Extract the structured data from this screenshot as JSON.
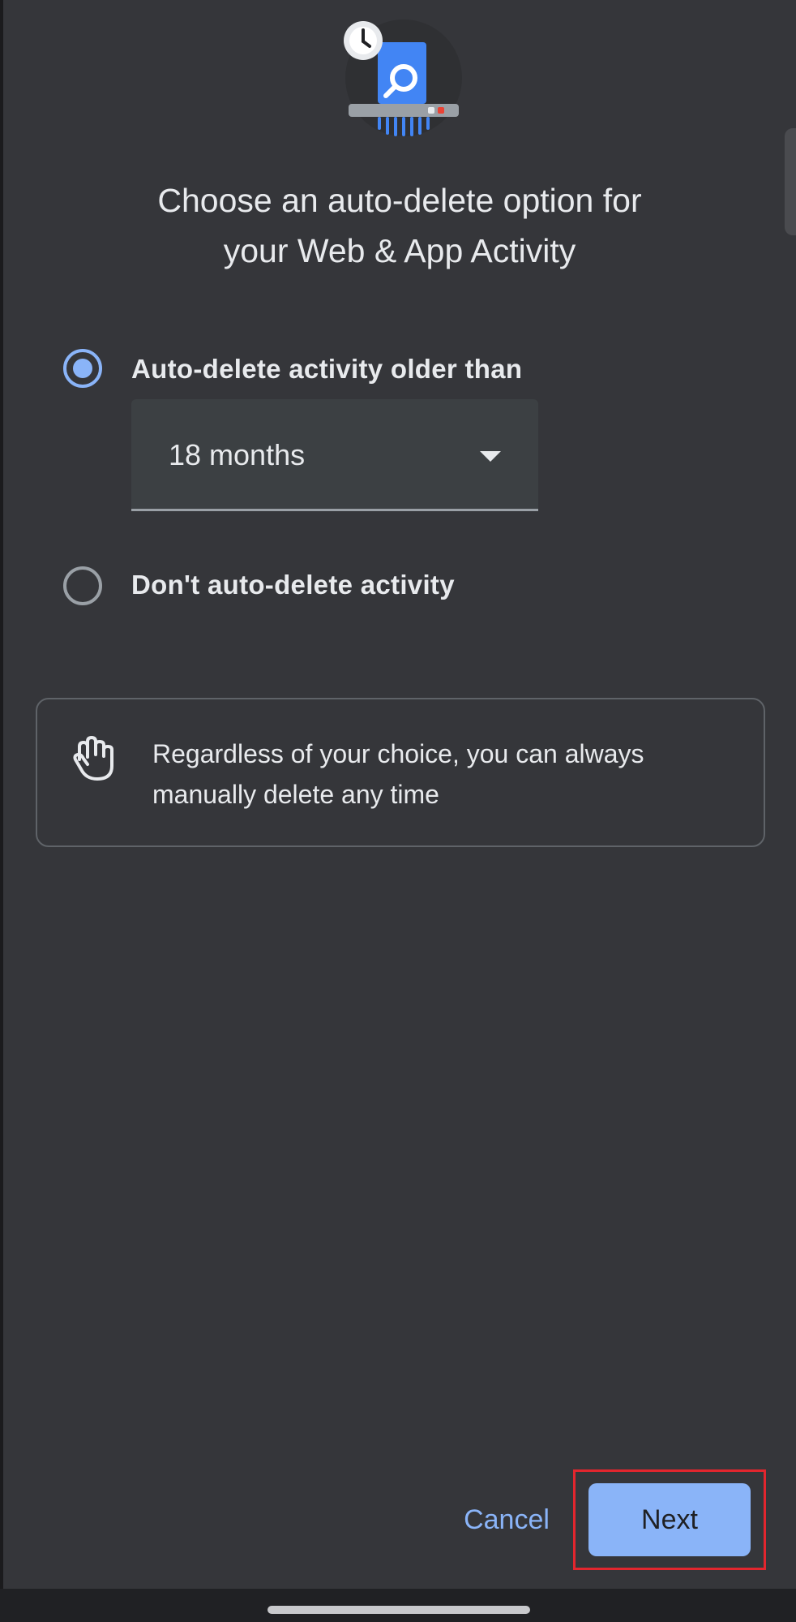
{
  "dialog": {
    "title_line1": "Choose an auto-delete option for",
    "title_line2": "your Web & App Activity"
  },
  "options": [
    {
      "label": "Auto-delete activity older than",
      "selected": true
    },
    {
      "label": "Don't auto-delete activity",
      "selected": false
    }
  ],
  "dropdown": {
    "value": "18 months"
  },
  "info": {
    "line1": "Regardless of your choice, you can always",
    "line2": "manually delete any time"
  },
  "actions": {
    "cancel_label": "Cancel",
    "next_label": "Next"
  },
  "colors": {
    "accent": "#8ab4f8",
    "surface": "#35363a",
    "text": "#e8eaed",
    "highlight": "#e3262e"
  },
  "icons": {
    "hero": "activity-shredder-icon",
    "clock": "clock-icon",
    "search": "magnifier-icon",
    "info": "hand-gesture-icon",
    "dropdown": "caret-down-icon"
  }
}
